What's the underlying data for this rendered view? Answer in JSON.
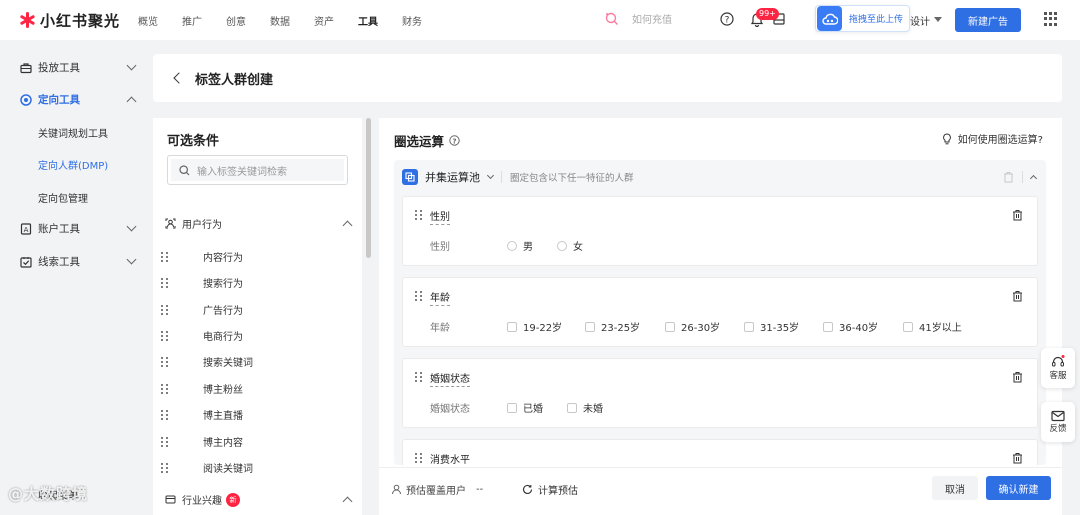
{
  "app": {
    "logo_text": "小红书聚光",
    "brand_color": "#ff2442",
    "accent_color": "#2f6fe4"
  },
  "nav": {
    "items": [
      "概览",
      "推广",
      "创意",
      "数据",
      "资产",
      "工具",
      "财务"
    ],
    "active": "工具"
  },
  "search": {
    "placeholder": "如何充值"
  },
  "notifications": {
    "badge": "99+"
  },
  "upload_popup": {
    "text": "拖拽至此上传"
  },
  "design_menu": {
    "label": "设计"
  },
  "new_ad_button": "新建广告",
  "sidebar": {
    "groups": [
      {
        "label": "投放工具",
        "icon": "briefcase-icon",
        "expanded": false
      },
      {
        "label": "定向工具",
        "icon": "target-icon",
        "expanded": true,
        "children": [
          "关键词规划工具",
          "定向人群(DMP)",
          "定向包管理"
        ],
        "active_child": "定向人群(DMP)"
      },
      {
        "label": "账户工具",
        "icon": "account-icon",
        "expanded": false
      },
      {
        "label": "线索工具",
        "icon": "lead-icon",
        "expanded": false
      }
    ],
    "partial_bottom_label": "收起菜单"
  },
  "page": {
    "title": "标签人群创建"
  },
  "left_panel": {
    "title": "可选条件",
    "search_placeholder": "输入标签关键词检索",
    "categories": [
      {
        "label": "用户行为",
        "icon": "user-behavior-icon",
        "expanded": true,
        "items": [
          "内容行为",
          "搜索行为",
          "广告行为",
          "电商行为",
          "搜索关键词",
          "博主粉丝",
          "博主直播",
          "博主内容",
          "阅读关键词"
        ]
      },
      {
        "label": "行业兴趣",
        "icon": "industry-icon",
        "badge": "新",
        "expanded": true
      }
    ]
  },
  "right_panel": {
    "title": "圈选运算",
    "help_link": "如何使用圈选运算?",
    "pool": {
      "name": "并集运算池",
      "description": "圈定包含以下任一特征的人群",
      "cards": [
        {
          "title": "性别",
          "field": "性别",
          "type": "radio",
          "options": [
            "男",
            "女"
          ]
        },
        {
          "title": "年龄",
          "field": "年龄",
          "type": "checkbox",
          "options": [
            "19-22岁",
            "23-25岁",
            "26-30岁",
            "31-35岁",
            "36-40岁",
            "41岁以上"
          ]
        },
        {
          "title": "婚姻状态",
          "field": "婚姻状态",
          "type": "checkbox",
          "options": [
            "已婚",
            "未婚"
          ]
        },
        {
          "title": "消费水平"
        }
      ]
    },
    "footer": {
      "estimate_label": "预估覆盖用户",
      "estimate_value": "--",
      "calc_label": "计算预估",
      "cancel": "取消",
      "confirm": "确认新建"
    }
  },
  "floating": {
    "service": "客服",
    "feedback": "反馈"
  },
  "watermark": "@大数跨境"
}
